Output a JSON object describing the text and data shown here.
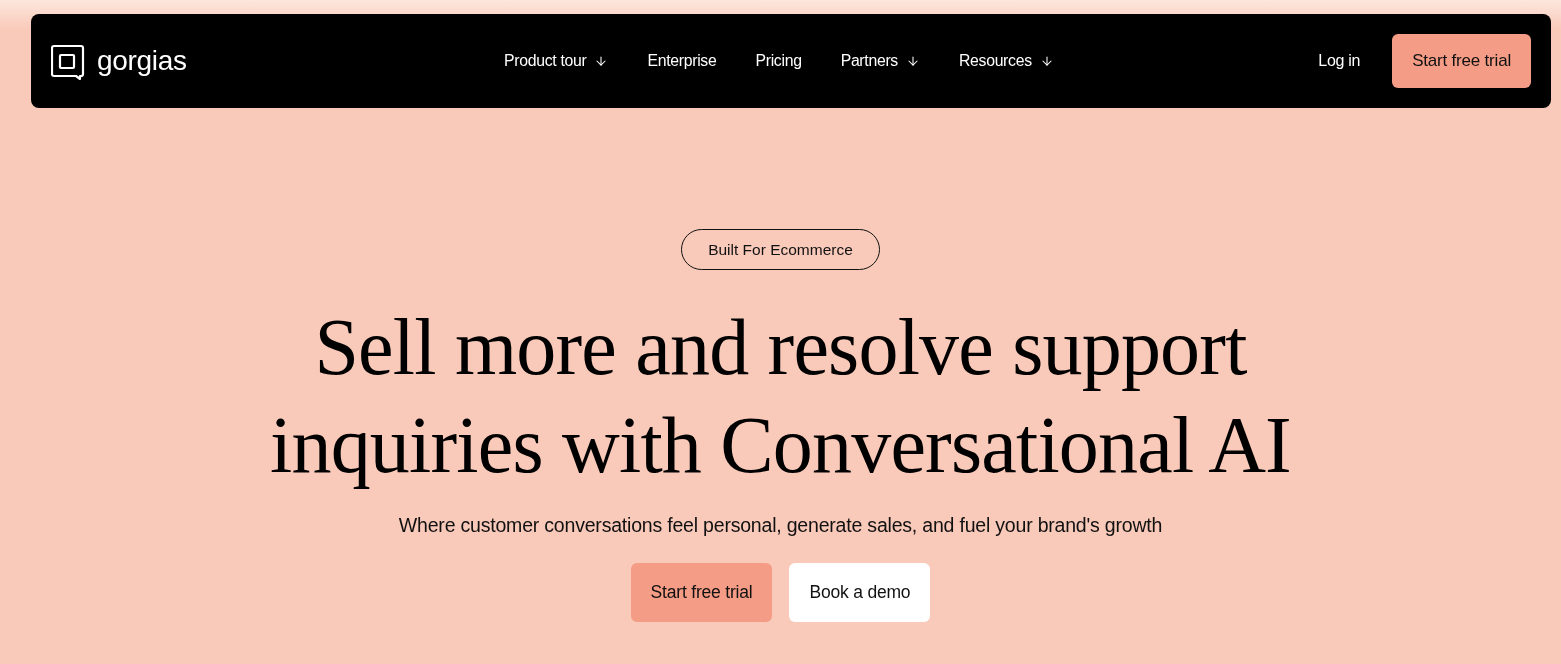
{
  "nav": {
    "logo": "gorgias",
    "links": [
      {
        "label": "Product tour",
        "dropdown": true
      },
      {
        "label": "Enterprise",
        "dropdown": false
      },
      {
        "label": "Pricing",
        "dropdown": false
      },
      {
        "label": "Partners",
        "dropdown": true
      },
      {
        "label": "Resources",
        "dropdown": true
      }
    ],
    "login": "Log in",
    "cta": "Start free trial"
  },
  "hero": {
    "badge": "Built For Ecommerce",
    "title_lines": [
      "Sell more and resolve support",
      "inquiries with Conversational AI"
    ],
    "subtitle": "Where customer conversations feel personal, generate sales, and fuel your brand's growth",
    "buttons": [
      {
        "label": "Start free trial",
        "kind": "primary"
      },
      {
        "label": "Book a demo",
        "kind": "secondary"
      }
    ]
  }
}
